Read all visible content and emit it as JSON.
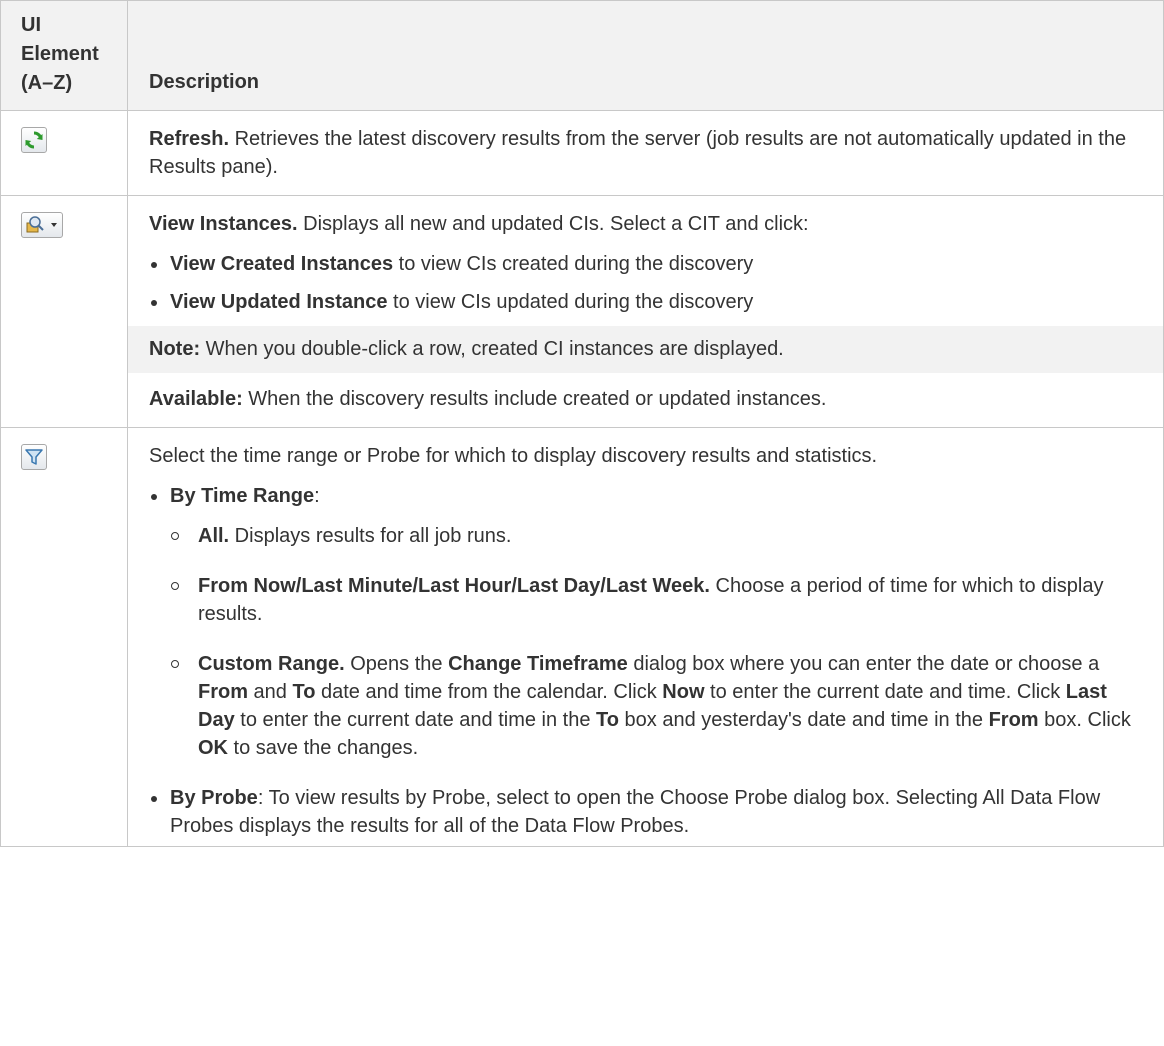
{
  "header": {
    "col1": "UI Element (A–Z)",
    "col1_lines": [
      "UI",
      "Element",
      "(A–Z)"
    ],
    "col2": "Description"
  },
  "rows": {
    "refresh": {
      "icon": "refresh-icon",
      "title": "Refresh.",
      "text": " Retrieves the latest discovery results from the server (job results are not automatically updated in the Results pane)."
    },
    "view_instances": {
      "icon": "view-instances-icon",
      "title": "View Instances.",
      "text": " Displays all new and updated CIs. Select a CIT and click:",
      "b1_bold": "View Created Instances",
      "b1_text": " to view CIs created during the discovery",
      "b2_bold": "View Updated Instance",
      "b2_text": " to view CIs updated during the discovery",
      "note_bold": "Note:",
      "note_text": " When you double-click a row, created CI instances are displayed.",
      "avail_bold": "Available:",
      "avail_text": " When the discovery results include created or updated instances."
    },
    "filter": {
      "icon": "filter-icon",
      "intro": "Select the time range or Probe for which to display discovery results and statistics.",
      "b1_bold": "By Time Range",
      "b1_text": ":",
      "s1_bold": "All.",
      "s1_text": " Displays results for all job runs.",
      "s2_bold": "From Now/Last Minute/Last Hour/Last Day/Last Week.",
      "s2_text": " Choose a period of time for which to display results.",
      "s3_bold": "Custom Range.",
      "s3_t1": " Opens the ",
      "s3_b2": "Change Timeframe",
      "s3_t2": " dialog box where you can enter the date or choose a ",
      "s3_b3": "From",
      "s3_t3": " and ",
      "s3_b4": "To",
      "s3_t4": " date and time from the calendar. Click ",
      "s3_b5": "Now",
      "s3_t5": " to enter the current date and time. Click ",
      "s3_b6": "Last Day",
      "s3_t6": " to enter the current date and time in the ",
      "s3_b7": "To",
      "s3_t7": " box and yesterday's date and time in the ",
      "s3_b8": "From",
      "s3_t8": " box. Click ",
      "s3_b9": "OK",
      "s3_t9": " to save the changes.",
      "b2_bold": "By Probe",
      "b2_text": ": To view results by Probe, select to open the Choose Probe dialog box. Selecting All Data Flow Probes displays the results for all of the Data Flow Probes."
    }
  }
}
